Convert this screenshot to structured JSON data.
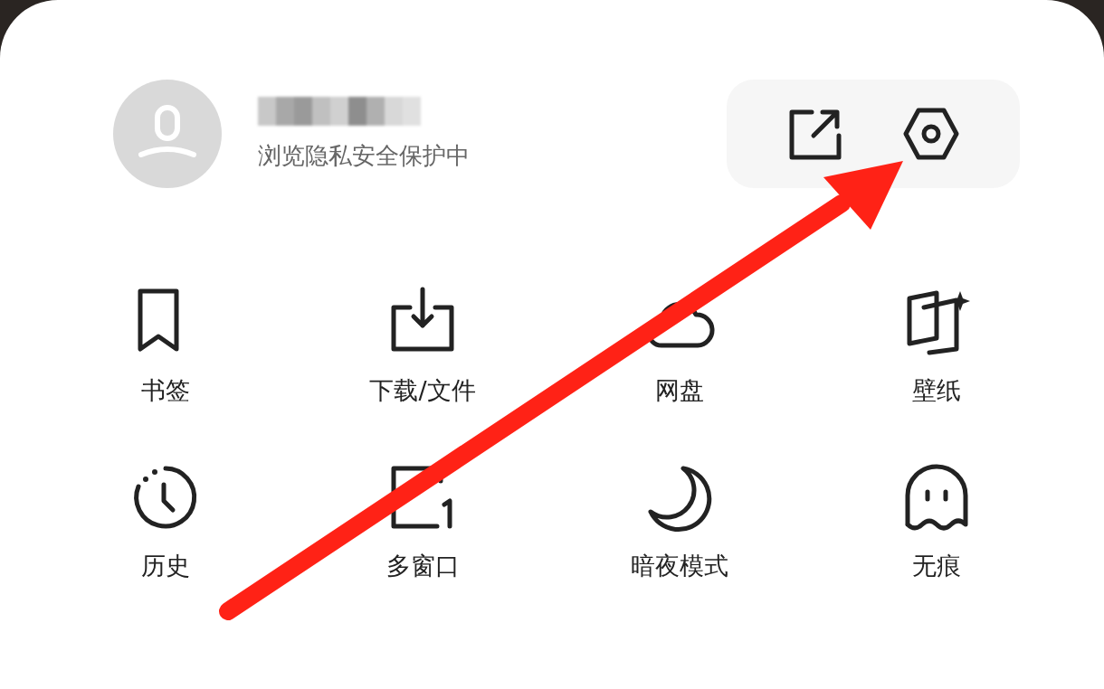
{
  "profile": {
    "subtitle": "浏览隐私安全保护中"
  },
  "actions": [
    {
      "kind": "share"
    },
    {
      "kind": "settings"
    }
  ],
  "menu_items": [
    {
      "kind": "bookmark",
      "label": "书签"
    },
    {
      "kind": "download",
      "label": "下载/文件"
    },
    {
      "kind": "cloud",
      "label": "网盘"
    },
    {
      "kind": "wallpaper",
      "label": "壁纸"
    },
    {
      "kind": "history",
      "label": "历史"
    },
    {
      "kind": "windows",
      "label": "多窗口"
    },
    {
      "kind": "moon",
      "label": "暗夜模式"
    },
    {
      "kind": "ghost",
      "label": "无痕"
    }
  ],
  "annotation": {
    "kind": "arrow",
    "color": "#ff2216"
  }
}
